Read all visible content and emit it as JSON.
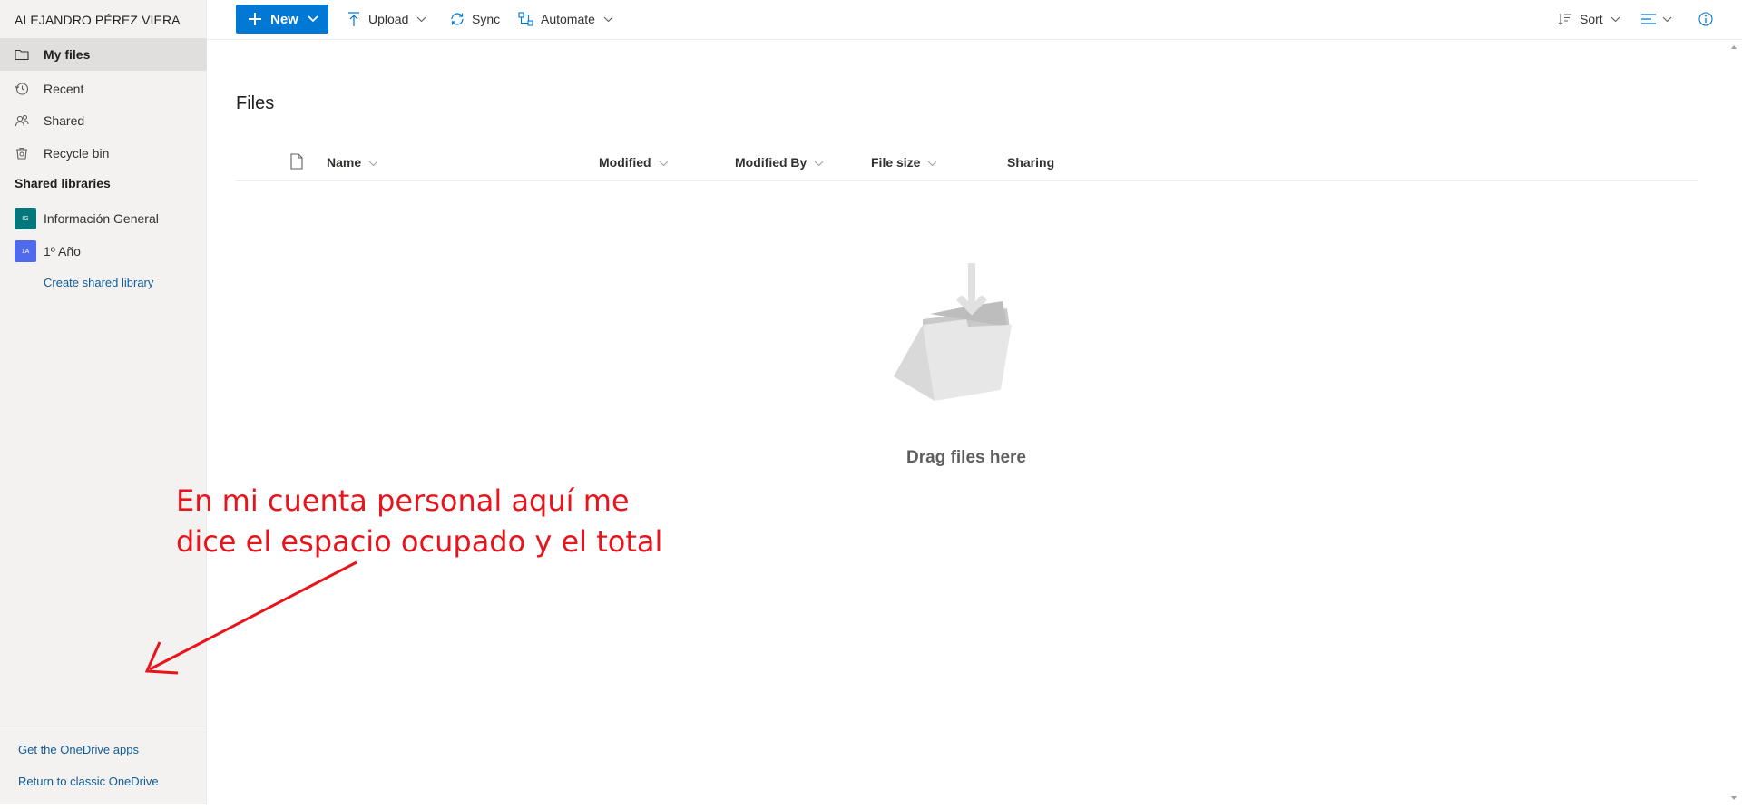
{
  "sidebar": {
    "user_name": "ALEJANDRO PÉREZ VIERA",
    "nav": [
      {
        "label": "My files",
        "icon": "folder-icon",
        "active": true
      },
      {
        "label": "Recent",
        "icon": "history-icon",
        "active": false
      },
      {
        "label": "Shared",
        "icon": "people-icon",
        "active": false
      },
      {
        "label": "Recycle bin",
        "icon": "recycle-bin-icon",
        "active": false
      }
    ],
    "shared_libraries_title": "Shared libraries",
    "libraries": [
      {
        "label": "Información General",
        "badge": "IG",
        "color": "#03787c"
      },
      {
        "label": "1º Año",
        "badge": "1A",
        "color": "#4f6bed"
      }
    ],
    "create_library": "Create shared library",
    "footer": {
      "get_apps": "Get the OneDrive apps",
      "classic": "Return to classic OneDrive"
    }
  },
  "commandbar": {
    "new": "New",
    "upload": "Upload",
    "sync": "Sync",
    "automate": "Automate",
    "sort": "Sort"
  },
  "main": {
    "title": "Files",
    "columns": {
      "name": "Name",
      "modified": "Modified",
      "modified_by": "Modified By",
      "file_size": "File size",
      "sharing": "Sharing"
    },
    "empty_state": "Drag files here"
  },
  "annotation": {
    "line1": "En mi cuenta personal aquí me",
    "line2": "dice el espacio ocupado y el total"
  },
  "colors": {
    "accent": "#0078d4",
    "sidebar_bg": "#f3f2f1",
    "link": "#0f5c9a",
    "annotation": "#e8141c"
  }
}
